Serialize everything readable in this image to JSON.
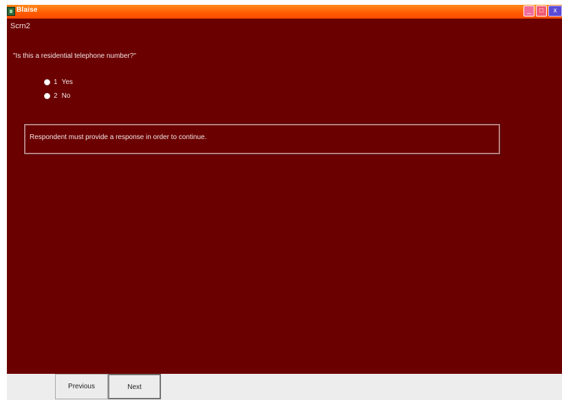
{
  "window": {
    "title": "Blaise",
    "minimize_glyph": "_",
    "maximize_glyph": "□",
    "close_glyph": "x"
  },
  "screen": {
    "id_label": "Scrn2",
    "question": "\"Is this a residential telephone number?\"",
    "options": [
      {
        "num": "1",
        "label": "Yes",
        "selected": false
      },
      {
        "num": "2",
        "label": "No",
        "selected": false
      }
    ],
    "message": "Respondent must provide a response in order to continue."
  },
  "footer": {
    "previous_label": "Previous",
    "next_label": "Next"
  },
  "colors": {
    "titlebar": "#ff5a00",
    "content_background": "#6b0000",
    "footer_background": "#ededed"
  }
}
